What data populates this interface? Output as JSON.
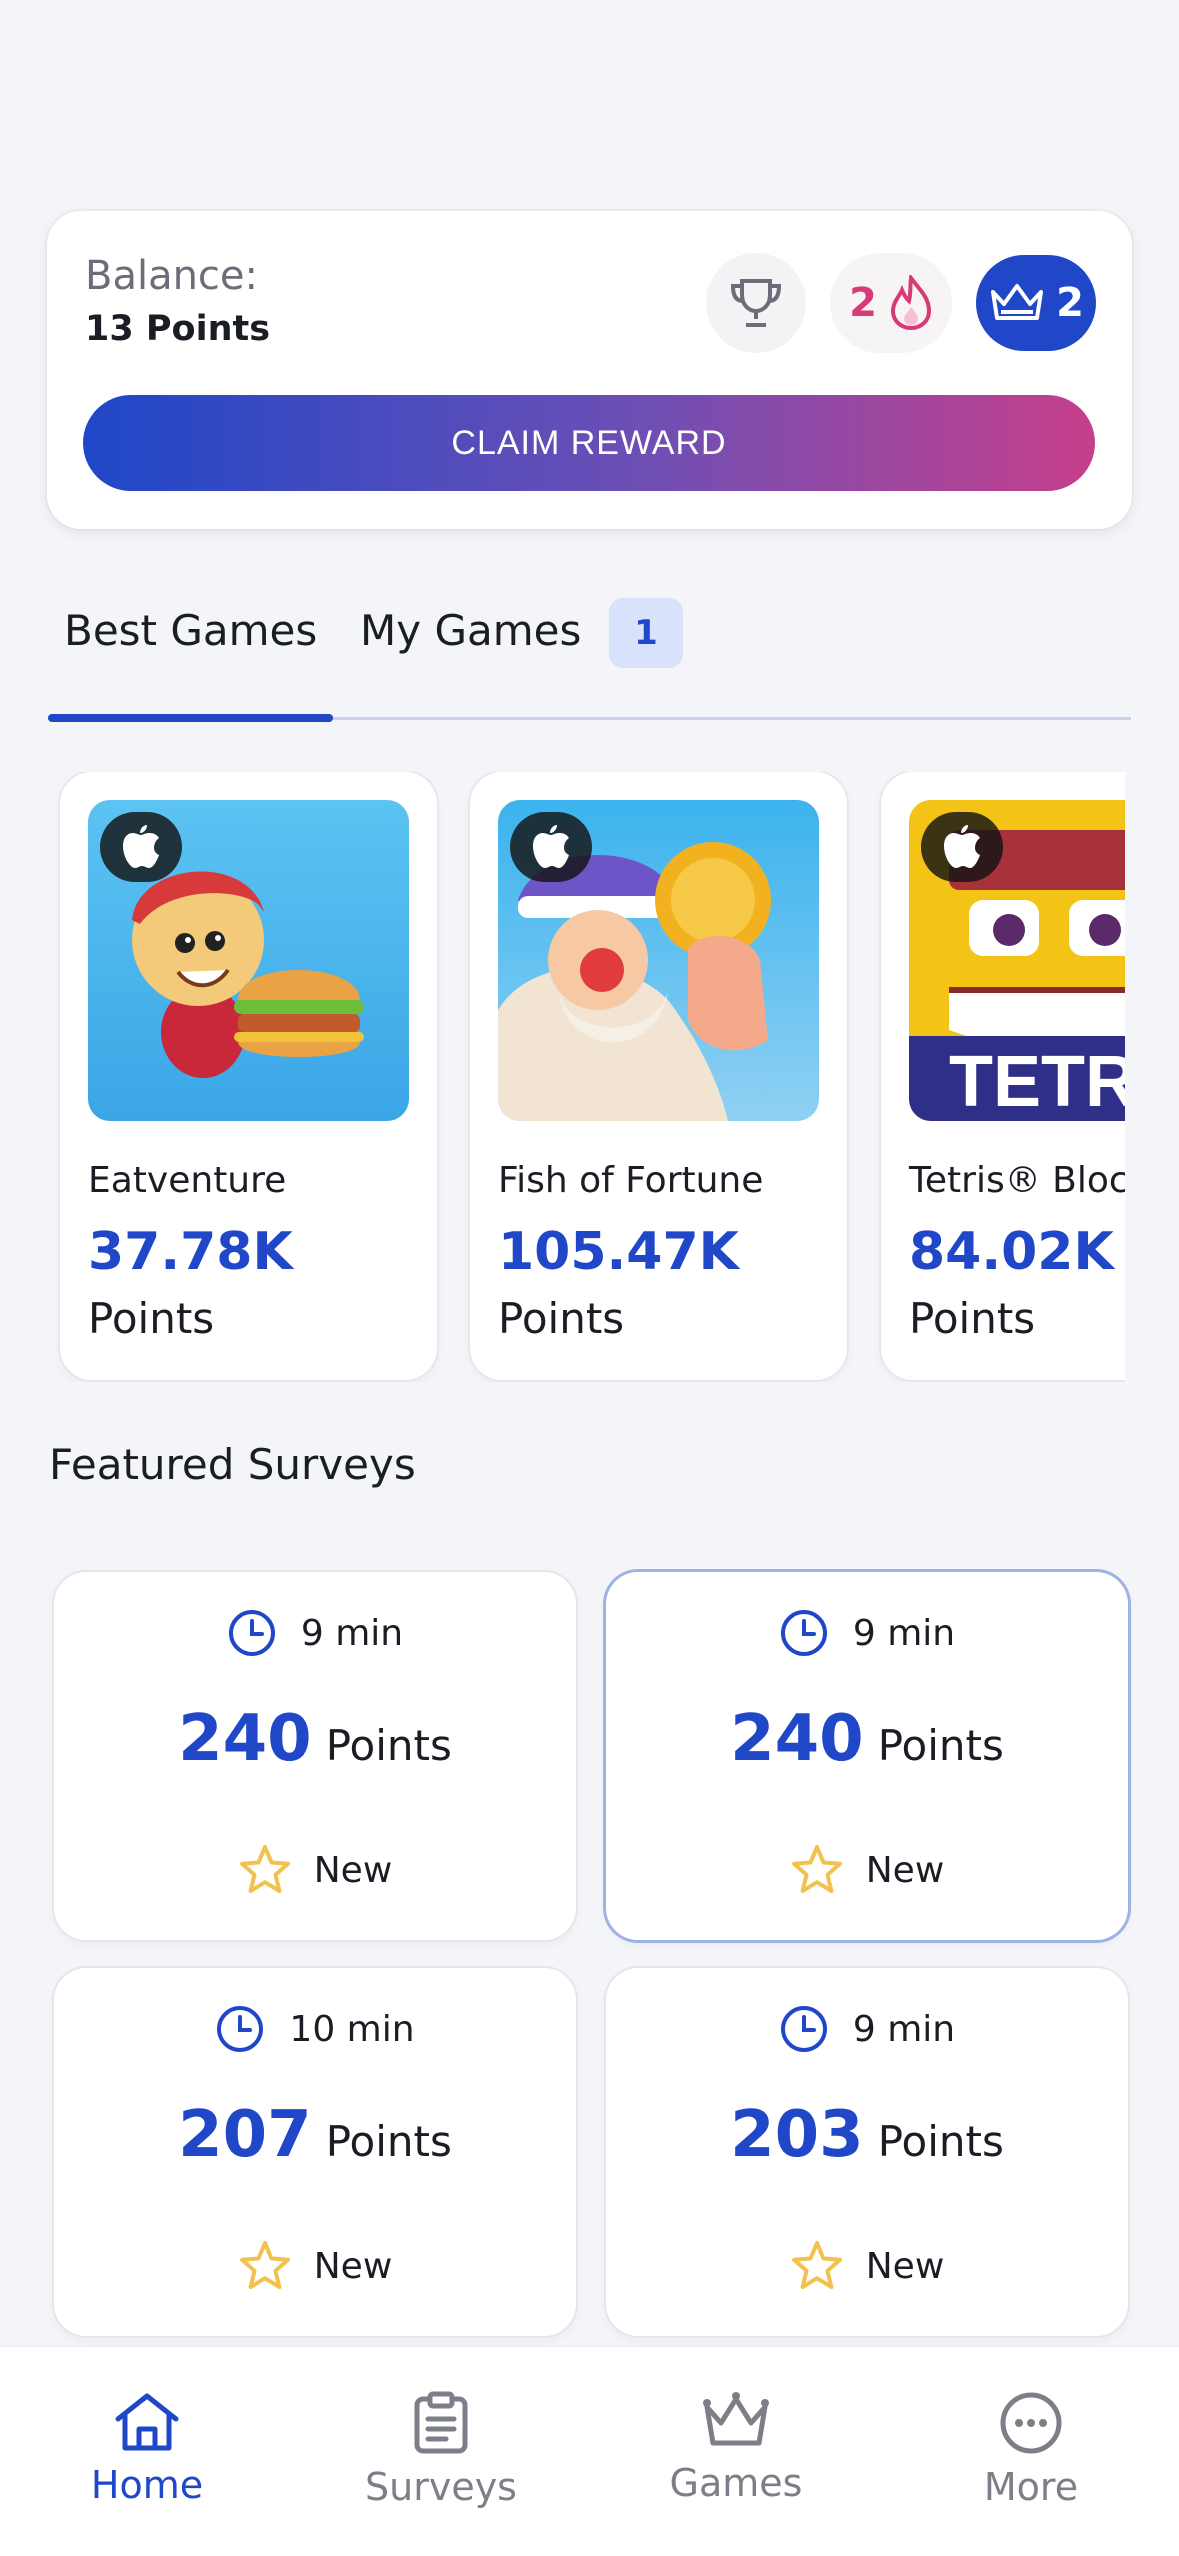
{
  "balance": {
    "label": "Balance:",
    "value": "13 Points",
    "streak_count": "2",
    "crown_count": "2",
    "claim_label": "CLAIM REWARD"
  },
  "tabs": {
    "best_label": "Best Games",
    "my_label": "My Games",
    "my_count": "1",
    "active": "Best Games"
  },
  "games": [
    {
      "name": "Eatventure",
      "points": "37.78K",
      "points_label": "Points",
      "platform_icon": "apple-icon"
    },
    {
      "name": "Fish of Fortune",
      "points": "105.47K",
      "points_label": "Points",
      "platform_icon": "apple-icon"
    },
    {
      "name": "Tetris® Bloc",
      "points": "84.02K",
      "points_label": "Points",
      "platform_icon": "apple-icon",
      "thumb_text": "TETRI"
    }
  ],
  "surveys_section": {
    "title": "Featured Surveys"
  },
  "surveys": [
    {
      "time": "9 min",
      "points": "240",
      "points_label": "Points",
      "tag": "New"
    },
    {
      "time": "9 min",
      "points": "240",
      "points_label": "Points",
      "tag": "New"
    },
    {
      "time": "10 min",
      "points": "207",
      "points_label": "Points",
      "tag": "New"
    },
    {
      "time": "9 min",
      "points": "203",
      "points_label": "Points",
      "tag": "New"
    }
  ],
  "nav": {
    "home": "Home",
    "surveys": "Surveys",
    "games": "Games",
    "more": "More",
    "active": "Home"
  },
  "colors": {
    "accent": "#1f47c8",
    "gradient_end": "#c63f8c",
    "streak": "#d63a77",
    "star": "#f2c14e"
  }
}
